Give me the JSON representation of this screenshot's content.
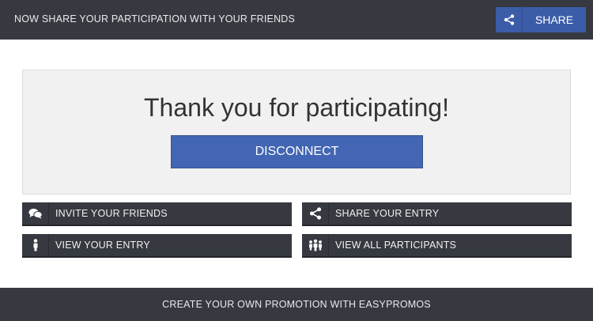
{
  "header": {
    "message": "NOW SHARE YOUR PARTICIPATION WITH YOUR FRIENDS",
    "share_label": "SHARE",
    "share_icon": "share-icon"
  },
  "main": {
    "thanks_text": "Thank you for participating!",
    "disconnect_label": "DISCONNECT"
  },
  "actions": [
    {
      "label": "INVITE YOUR FRIENDS",
      "icon": "chat-bubbles-icon"
    },
    {
      "label": "SHARE YOUR ENTRY",
      "icon": "share-icon"
    },
    {
      "label": "VIEW YOUR ENTRY",
      "icon": "person-icon"
    },
    {
      "label": "VIEW ALL PARTICIPANTS",
      "icon": "group-icon"
    }
  ],
  "footer": {
    "text": "CREATE YOUR OWN PROMOTION WITH EASYPROMOS"
  },
  "colors": {
    "bar": "#363940",
    "accent": "#4266b4",
    "panel": "#f1f1f1"
  }
}
